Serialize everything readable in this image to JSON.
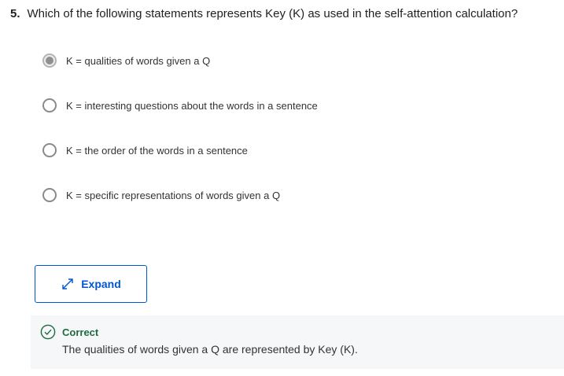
{
  "question": {
    "number": "5.",
    "text": "Which of the following statements represents Key (K) as used in the self-attention calculation?"
  },
  "options": [
    {
      "label": "K = qualities of words given a Q",
      "selected": true
    },
    {
      "label": "K = interesting questions about the words in a sentence",
      "selected": false
    },
    {
      "label": "K = the order of the words in a sentence",
      "selected": false
    },
    {
      "label": "K = specific representations of words given a Q",
      "selected": false
    }
  ],
  "expand": {
    "label": "Expand",
    "icon": "expand-arrows-icon"
  },
  "feedback": {
    "icon": "check-circle-icon",
    "status": "Correct",
    "text": "The qualities of words given a Q are represented by Key (K)."
  },
  "colors": {
    "accent": "#0056d2",
    "correct": "#1f6b3f",
    "feedback_bg": "#f5f7f8"
  }
}
